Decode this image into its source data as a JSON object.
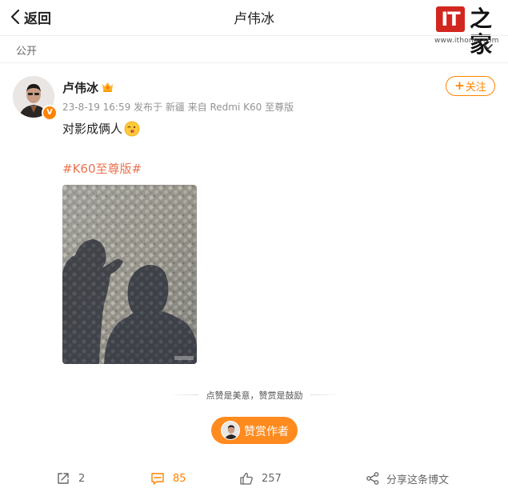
{
  "nav": {
    "back_label": "返回",
    "title": "卢伟冰",
    "logo_text": "IT",
    "logo_glyph": "之家",
    "logo_url": "www.ithome.com"
  },
  "visibility": {
    "label": "公开"
  },
  "author": {
    "name": "卢伟冰",
    "verified_badge": "V",
    "meta": "23-8-19 16:59  发布于 新疆  来自 Redmi K60 至尊版",
    "follow_label": "关注",
    "follow_icon": "plus-icon"
  },
  "post": {
    "text": "对影成俩人",
    "emoji": "wink-emoji",
    "hashtag": "#K60至尊版#"
  },
  "reward": {
    "text": "点赞是美意，赞赏是鼓励",
    "button_label": "赞赏作者"
  },
  "actions": {
    "repost_count": "2",
    "comment_count": "85",
    "like_count": "257",
    "share_label": "分享这条博文"
  },
  "colors": {
    "accent": "#ff8200",
    "hashtag": "#eb7350",
    "brand_red": "#d2271f"
  }
}
